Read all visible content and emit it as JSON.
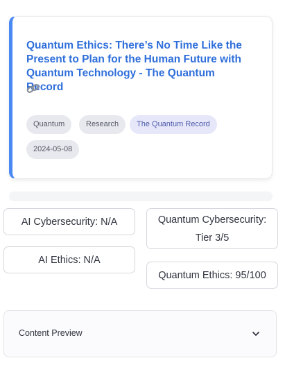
{
  "article": {
    "title": "Quantum Ethics: There’s No Time Like the Present to Plan for the Human Future with Quantum Technology - The Quantum Record",
    "tags": [
      "Quantum",
      "Research"
    ],
    "source": "The Quantum Record",
    "date": "2024-05-08",
    "link_icon": "link-icon",
    "accent_color": "#4a89f3",
    "title_color": "#2f6fdb"
  },
  "metrics": {
    "ai_cybersecurity": "AI Cybersecurity: N/A",
    "ai_ethics": "AI Ethics: N/A",
    "quantum_cybersecurity_line1": "Quantum Cybersecurity:",
    "quantum_cybersecurity_line2": "Tier 3/5",
    "quantum_ethics": "Quantum Ethics: 95/100"
  },
  "preview": {
    "label": "Content Preview",
    "icon": "chevron-down-icon"
  }
}
